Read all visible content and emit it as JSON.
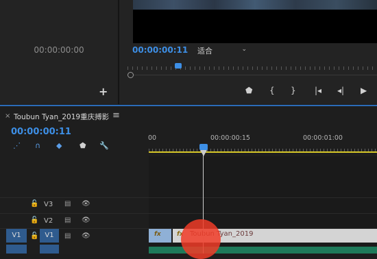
{
  "source_monitor": {
    "timecode": "00:00:00:00",
    "add_label": "+"
  },
  "program_monitor": {
    "timecode": "00:00:00:11",
    "fit_label": "适合",
    "fit_chevron": "⌄",
    "transport": {
      "marker": "⬟",
      "in": "{",
      "out": "}",
      "go_in": "|◂",
      "step_back": "◂|",
      "play": "▶"
    }
  },
  "timeline": {
    "close": "×",
    "title": "Toubun Tyan_2019重庆搏影",
    "menu": "≡",
    "timecode": "00:00:00:11",
    "ruler": [
      "00",
      "00:00:00:15",
      "00:00:01:00"
    ],
    "tools": {
      "snap": "⋰",
      "link": "∩",
      "add_marker": "◆",
      "marker": "⬟",
      "settings": "🔧"
    },
    "tracks": [
      {
        "name": "V3",
        "lock": "🔓",
        "film": "▤",
        "eye": "👁"
      },
      {
        "name": "V2",
        "lock": "🔓",
        "film": "▤",
        "eye": "👁"
      },
      {
        "name": "V1",
        "lock": "🔓",
        "film": "▤",
        "eye": "👁",
        "source": "V1"
      }
    ],
    "clip": {
      "fx": "fx",
      "name": "Toubun Tyan_2019"
    }
  },
  "colors": {
    "accent": "#3d8fe6",
    "work_area": "#d8c828",
    "clip": "#d4d4d4",
    "annotation": "#f03c28"
  }
}
